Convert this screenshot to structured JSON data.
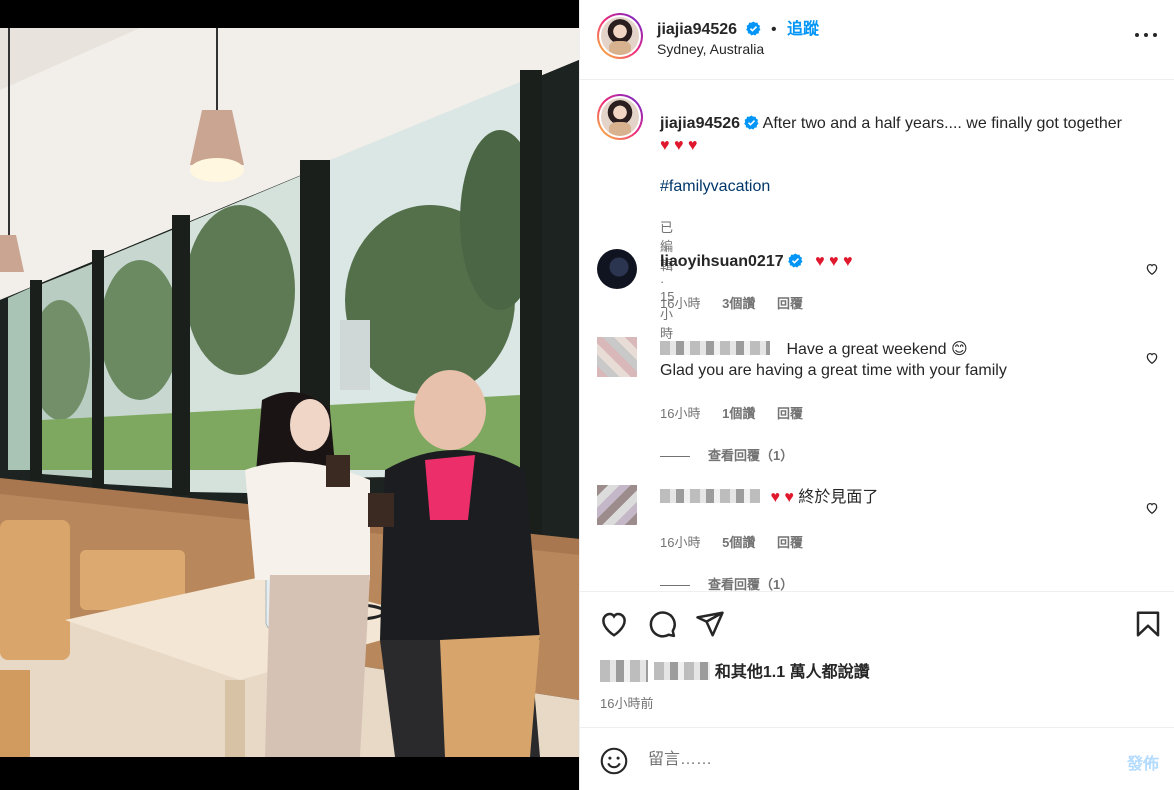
{
  "post": {
    "username": "jiajia94526",
    "follow_label": "追蹤",
    "separator": "•",
    "location": "Sydney, Australia"
  },
  "caption": {
    "username": "jiajia94526",
    "text": "After two and a half years.... we finally got together",
    "hearts": "♥ ♥ ♥",
    "hashtag": "#familyvacation",
    "meta": "已編輯 · 15小時"
  },
  "comments": [
    {
      "username": "liaoyihsuan0217",
      "text": "♥ ♥ ♥",
      "time": "16小時",
      "likes": "3個讚",
      "reply_label": "回覆"
    },
    {
      "line1": "Have a great weekend 😊",
      "line2": "Glad you are having a great time with your family",
      "time": "16小時",
      "likes": "1個讚",
      "reply_label": "回覆",
      "view_replies": "查看回覆（1）"
    },
    {
      "text": "終於見面了",
      "hearts": "♥ ♥",
      "time": "16小時",
      "likes": "5個讚",
      "reply_label": "回覆",
      "view_replies": "查看回覆（1）"
    }
  ],
  "actions": {
    "likes_text": "和其他1.1 萬人都說讚",
    "time_ago": "16小時前"
  },
  "comment_box": {
    "placeholder": "留言……",
    "post_label": "發佈"
  },
  "colors": {
    "link_blue": "#0095f6",
    "hashtag": "#00376b",
    "heart_red": "#e0182d",
    "muted": "#737373"
  },
  "icons": [
    "verified-icon",
    "more-icon",
    "heart-icon",
    "comment-icon",
    "share-icon",
    "bookmark-icon",
    "emoji-icon"
  ]
}
